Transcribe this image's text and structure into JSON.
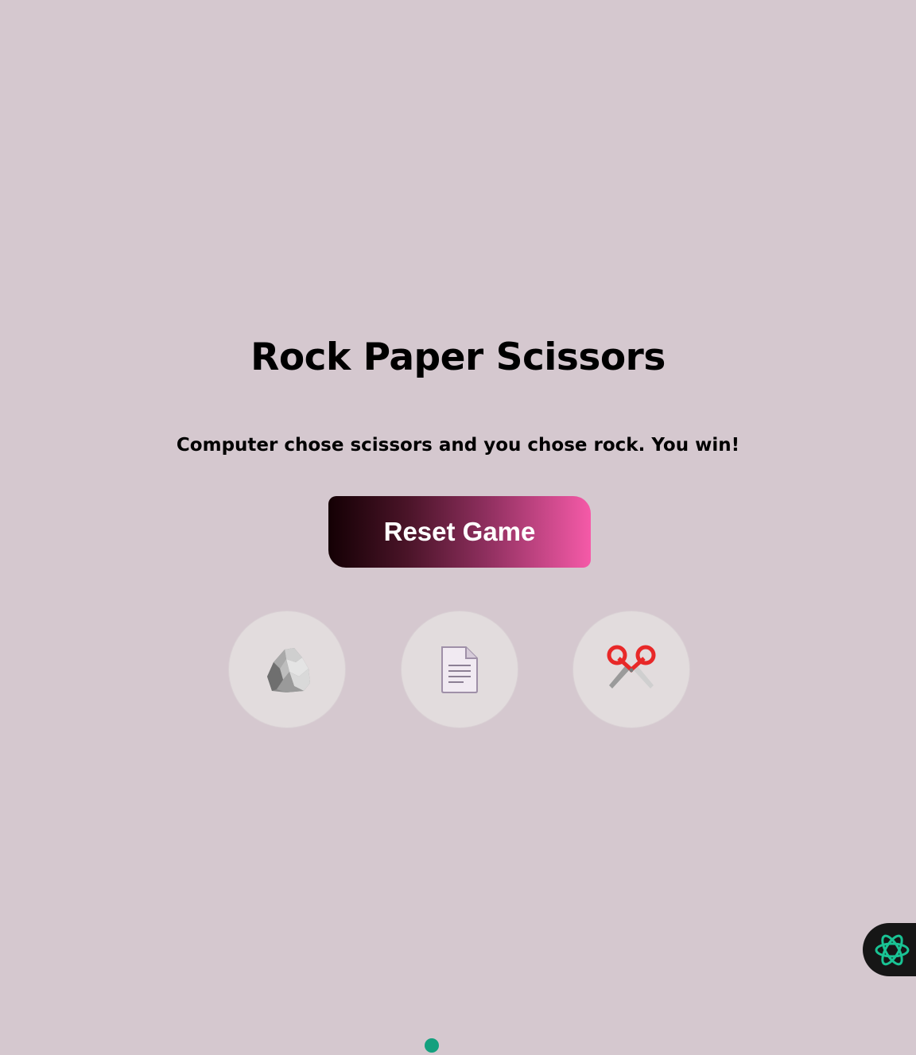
{
  "game": {
    "title": "Rock Paper Scissors",
    "result_message": "Computer chose scissors and you chose rock. You win!",
    "reset_label": "Reset Game"
  },
  "choices": [
    {
      "name": "rock",
      "icon": "rock-icon"
    },
    {
      "name": "paper",
      "icon": "paper-icon"
    },
    {
      "name": "scissors",
      "icon": "scissors-icon"
    }
  ],
  "widgets": {
    "chat_icon": "openai-logo-icon",
    "status_dot_color": "#14a07e"
  },
  "colors": {
    "background": "#d5c8cf",
    "button_gradient_start": "#140004",
    "button_gradient_end": "#f55aa8",
    "choice_bg": "#e2dcdd"
  }
}
